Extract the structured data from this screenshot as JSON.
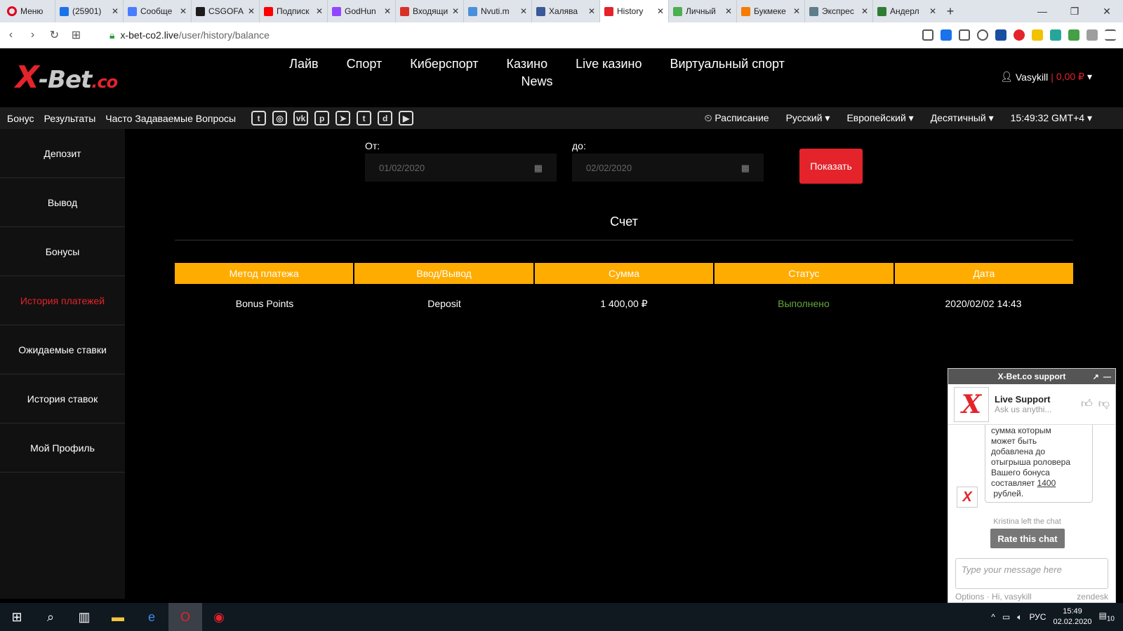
{
  "browser": {
    "menu_label": "Меню",
    "tabs": [
      {
        "title": "(25901)",
        "color": "#1a73e8"
      },
      {
        "title": "Сообще",
        "color": "#4a7cff"
      },
      {
        "title": "CSGOFA",
        "color": "#1c1c1c"
      },
      {
        "title": "Подписк",
        "color": "#ff0000"
      },
      {
        "title": "GodHun",
        "color": "#9147ff"
      },
      {
        "title": "Входящи",
        "color": "#d93025"
      },
      {
        "title": "Nvuti.m",
        "color": "#4a90d9"
      },
      {
        "title": "Халява",
        "color": "#3b5998"
      },
      {
        "title": "History",
        "color": "#e4232b",
        "active": true
      },
      {
        "title": "Личный",
        "color": "#4caf50"
      },
      {
        "title": "Букмеке",
        "color": "#f57c00"
      },
      {
        "title": "Экспрес",
        "color": "#607d8b"
      },
      {
        "title": "Андерл",
        "color": "#2e7d32"
      }
    ],
    "url_domain": "x-bet-co2.live",
    "url_path": "/user/history/balance"
  },
  "site": {
    "logo": {
      "x": "X",
      "bet": "-Bet",
      "co": ".co"
    },
    "nav": [
      "Лайв",
      "Спорт",
      "Киберспорт",
      "Казино",
      "Live казино",
      "Виртуальный спорт",
      "News"
    ],
    "user": {
      "name": "Vasykill",
      "balance": "0,00 ₽"
    },
    "subnav": {
      "links": [
        "Бонус",
        "Результаты",
        "Часто Задаваемые Вопросы"
      ],
      "social": [
        "twitter-icon",
        "instagram-icon",
        "vk-icon",
        "pinterest-icon",
        "telegram-icon",
        "tumblr-icon",
        "discord-icon",
        "youtube-icon"
      ],
      "schedule": "Расписание",
      "language": "Русский",
      "odds_region": "Европейский",
      "odds_format": "Десятичный",
      "time": "15:49:32 GMT+4"
    }
  },
  "sidebar": {
    "items": [
      {
        "label": "Депозит"
      },
      {
        "label": "Вывод"
      },
      {
        "label": "Бонусы"
      },
      {
        "label": "История платежей",
        "active": true
      },
      {
        "label": "Ожидаемые ставки"
      },
      {
        "label": "История ставок"
      },
      {
        "label": "Мой Профиль"
      }
    ]
  },
  "filter": {
    "from_label": "От:",
    "from_value": "01/02/2020",
    "to_label": "до:",
    "to_value": "02/02/2020",
    "show_button": "Показать"
  },
  "account": {
    "title": "Счет",
    "columns": [
      "Метод платежа",
      "Ввод/Вывод",
      "Сумма",
      "Статус",
      "Дата"
    ],
    "rows": [
      {
        "method": "Bonus Points",
        "type": "Deposit",
        "amount": "1 400,00 ₽",
        "status": "Выполнено",
        "date": "2020/02/02 14:43"
      }
    ],
    "header_color": "#ffac00",
    "status_ok_color": "#69a83b"
  },
  "chat": {
    "title": "X-Bet.co support",
    "agent_name": "Live Support",
    "agent_sub": "Ask us anythi...",
    "message_lines": [
      "сумма которым",
      "может быть",
      "добавлена до",
      "отыгрыша роловера",
      "Вашего бонуса",
      "составляет"
    ],
    "message_amount": "1400",
    "message_end": "рублей.",
    "left_notice": "Kristina left the chat",
    "rate_button": "Rate this chat",
    "input_placeholder": "Type your message here",
    "footer_options": "Options",
    "footer_greeting": "Hi, vasykill",
    "footer_brand": "zendesk"
  },
  "taskbar": {
    "lang": "РУС",
    "time": "15:49",
    "date": "02.02.2020",
    "notifications": "10"
  },
  "colors": {
    "accent": "#e4232b",
    "bg": "#000000",
    "sidebar_bg": "#111111"
  }
}
